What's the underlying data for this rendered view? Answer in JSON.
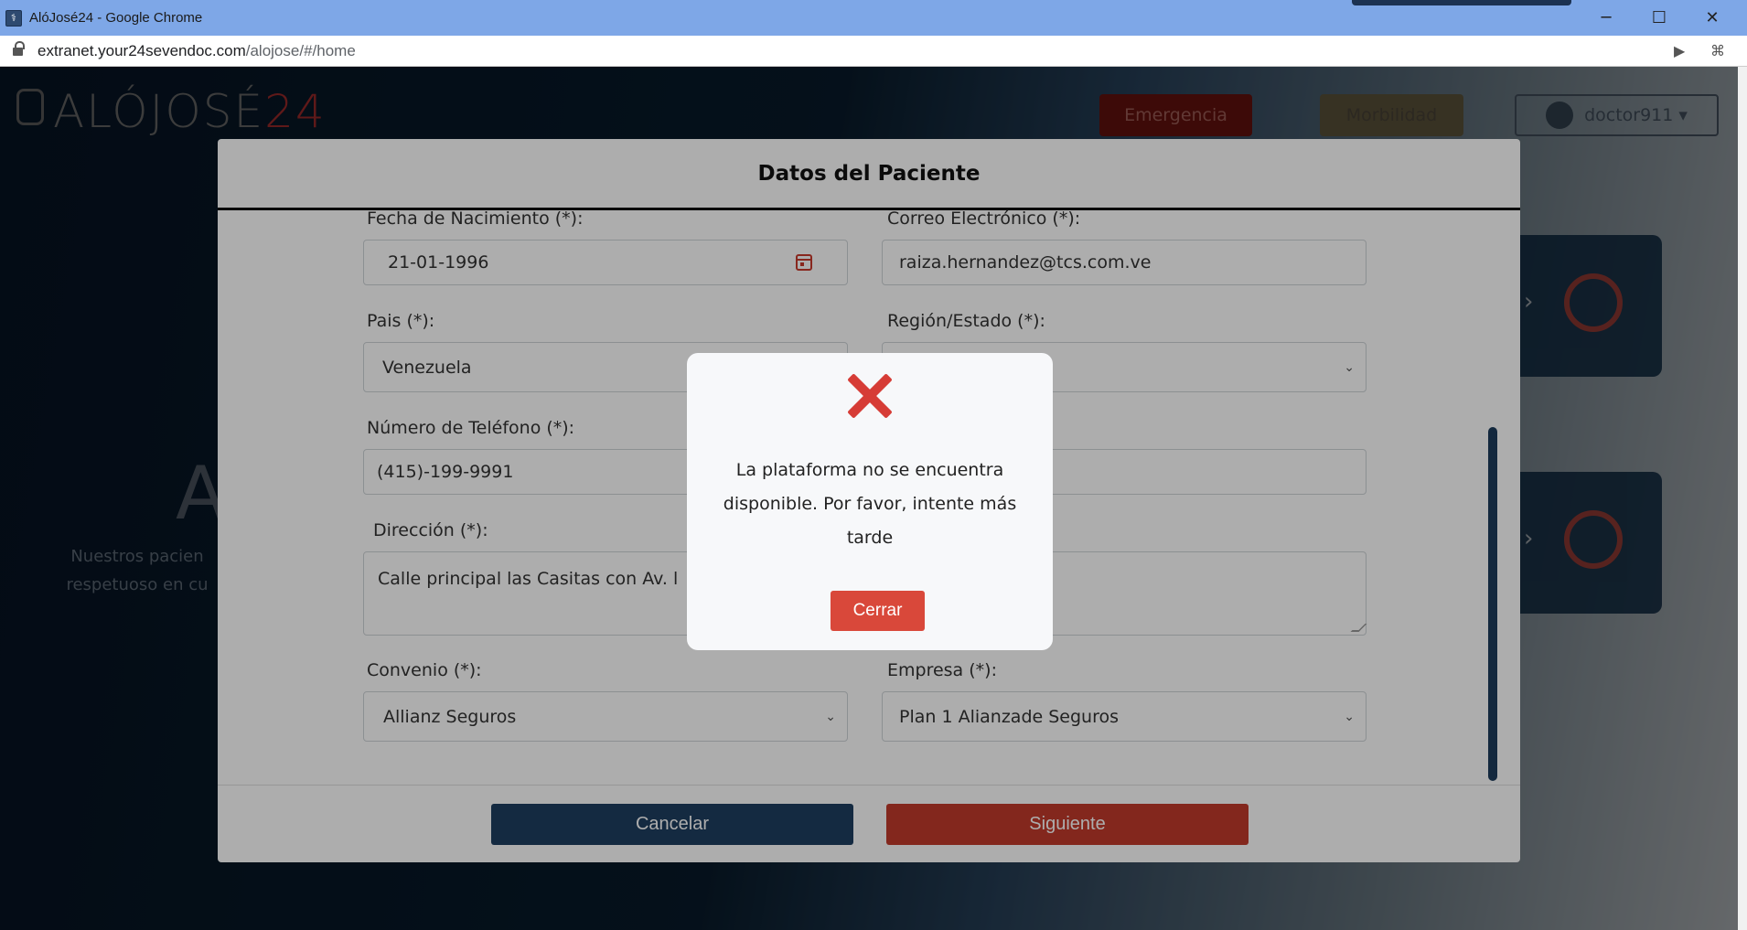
{
  "browser": {
    "window_title": "AlóJosé24 - Google Chrome",
    "url_host": "extranet.your24sevendoc.com",
    "url_path": "/alojose/#/home",
    "minimize_icon": "minimize-icon",
    "maximize_icon": "maximize-icon",
    "close_icon": "close-icon"
  },
  "site": {
    "logo_text": "ALÓJOSÉ",
    "logo_number": "24",
    "emergency_label": "Emergencia",
    "morbidity_label": "Morbilidad",
    "user_label": "doctor911",
    "hero_partial": "Al",
    "hero_line1": "Nuestros pacien",
    "hero_line2": "respetuoso en cu"
  },
  "patient_modal": {
    "title": "Datos del Paciente",
    "fields": {
      "birth_label": "Fecha de Nacimiento (*):",
      "birth_value": "21-01-1996",
      "email_label": "Correo Electrónico (*):",
      "email_value": "raiza.hernandez@tcs.com.ve",
      "country_label": "Pais (*):",
      "country_value": "Venezuela",
      "region_label": "Región/Estado (*):",
      "region_value": "",
      "phone_label": "Número de Teléfono (*):",
      "phone_value": "(415)-199-9991",
      "address_label": "Dirección (*):",
      "address_value": "Calle principal las Casitas con Av. l",
      "agreement_label": "Convenio (*):",
      "agreement_value": "Allianz Seguros",
      "company_label": "Empresa (*):",
      "company_value": "Plan 1 Alianzade Seguros"
    },
    "cancel_label": "Cancelar",
    "next_label": "Siguiente"
  },
  "alert": {
    "icon": "error-x-icon",
    "message": "La plataforma no se encuentra disponible. Por favor, intente más tarde",
    "close_label": "Cerrar"
  },
  "colors": {
    "accent_red": "#d9483a",
    "navy": "#1d3c5c",
    "title_bar": "#7ea7e7"
  }
}
